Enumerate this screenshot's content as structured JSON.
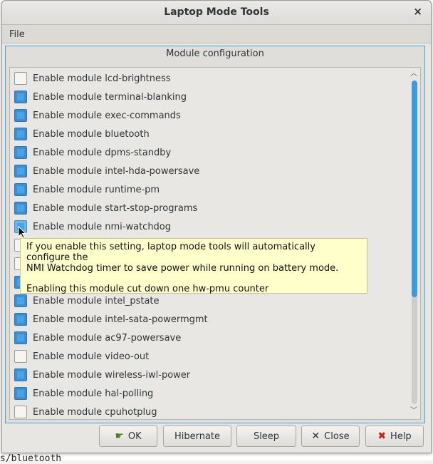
{
  "window": {
    "title": "Laptop Mode Tools",
    "close_glyph": "×"
  },
  "menubar": {
    "file_label": "File"
  },
  "group": {
    "legend": "Module configuration"
  },
  "modules": [
    {
      "label": "Enable module lcd-brightness",
      "checked": false
    },
    {
      "label": "Enable module terminal-blanking",
      "checked": true
    },
    {
      "label": "Enable module exec-commands",
      "checked": true
    },
    {
      "label": "Enable module bluetooth",
      "checked": true
    },
    {
      "label": "Enable module dpms-standby",
      "checked": true
    },
    {
      "label": "Enable module intel-hda-powersave",
      "checked": true
    },
    {
      "label": "Enable module runtime-pm",
      "checked": true
    },
    {
      "label": "Enable module start-stop-programs",
      "checked": true
    },
    {
      "label": "Enable module nmi-watchdog",
      "checked": true,
      "hover": true
    },
    {
      "label": "",
      "checked": false
    },
    {
      "label": "",
      "checked": false
    },
    {
      "label": "",
      "checked": true
    },
    {
      "label": "Enable module intel_pstate",
      "checked": true
    },
    {
      "label": "Enable module intel-sata-powermgmt",
      "checked": true
    },
    {
      "label": "Enable module ac97-powersave",
      "checked": true
    },
    {
      "label": "Enable module video-out",
      "checked": false
    },
    {
      "label": "Enable module wireless-iwl-power",
      "checked": true
    },
    {
      "label": "Enable module hal-polling",
      "checked": true
    },
    {
      "label": "Enable module cpuhotplug",
      "checked": false
    }
  ],
  "tooltip": {
    "line1": "If you enable this setting, laptop mode tools will automatically configure the",
    "line2": "NMI Watchdog timer to save power while running on battery mode.",
    "line3": "Enabling this module cut down one hw-pmu counter"
  },
  "buttons": {
    "ok": "OK",
    "hibernate": "Hibernate",
    "sleep": "Sleep",
    "close": "Close",
    "help": "Help"
  },
  "background_terminal": {
    "bottom_fragment": "s/bluetooth"
  },
  "colors": {
    "accent": "#3d8fd1",
    "group_border": "#46a5d8",
    "tooltip_bg": "#ffffcc"
  }
}
